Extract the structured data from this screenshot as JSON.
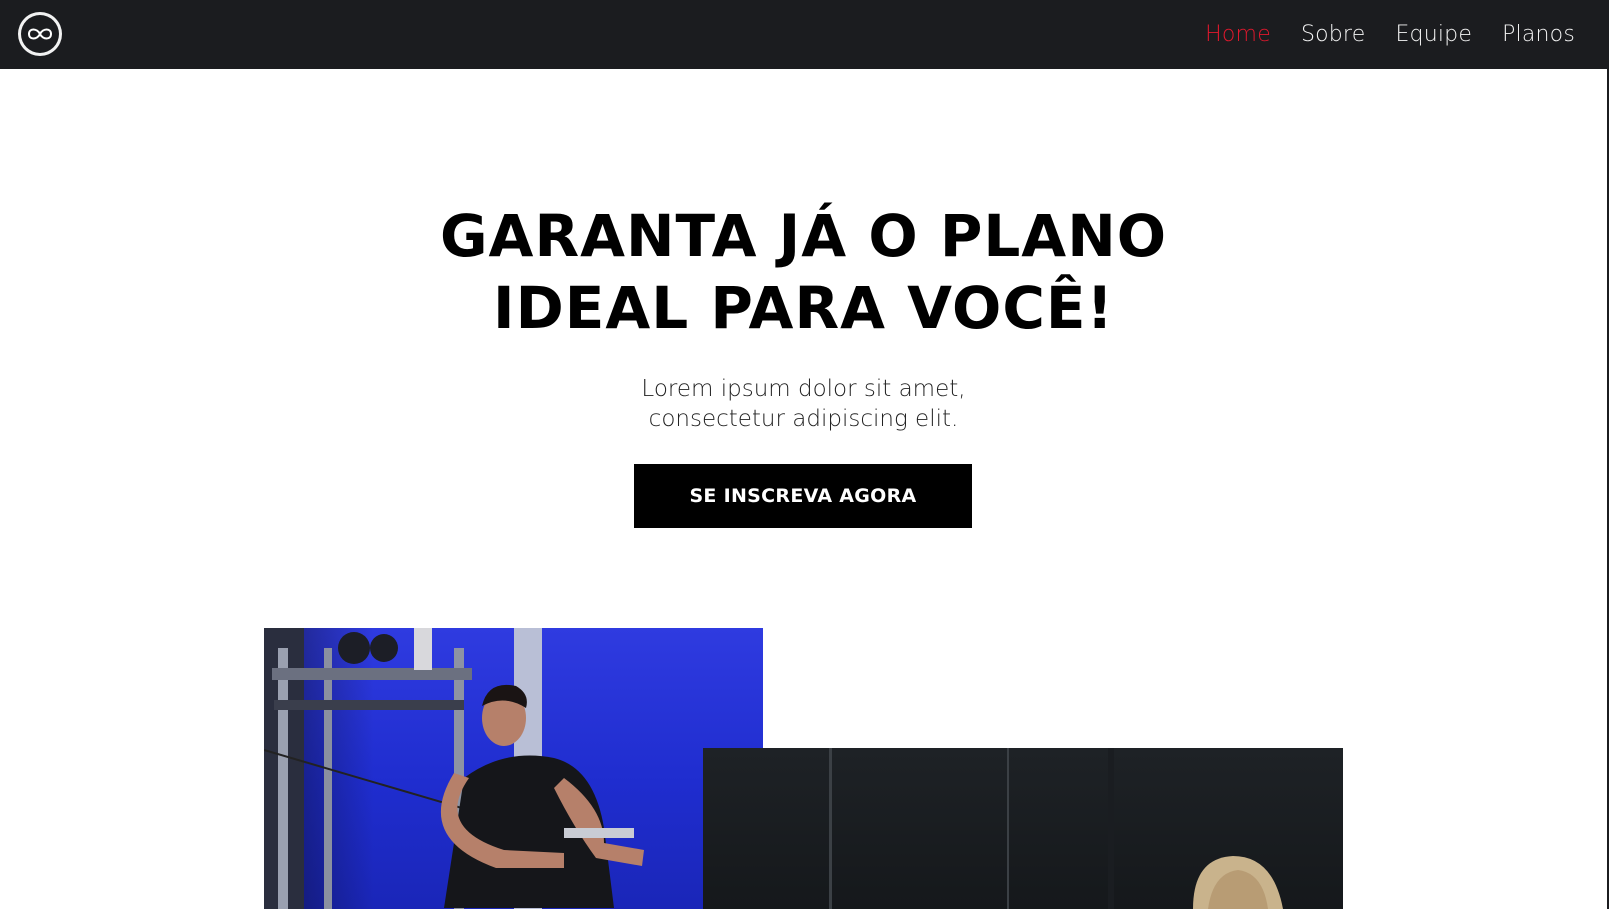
{
  "nav": {
    "logo_alt": "logo",
    "items": [
      {
        "label": "Home",
        "active": true
      },
      {
        "label": "Sobre",
        "active": false
      },
      {
        "label": "Equipe",
        "active": false
      },
      {
        "label": "Planos",
        "active": false
      }
    ]
  },
  "hero": {
    "title_line1": "GARANTA JÁ O PLANO",
    "title_line2": "IDEAL PARA VOCÊ!",
    "subtitle_line1": "Lorem ipsum dolor sit amet,",
    "subtitle_line2": "consectetur adipiscing elit.",
    "cta_label": "SE INSCREVA AGORA"
  },
  "colors": {
    "header_bg": "#1b1c1f",
    "active_link": "#e0182d",
    "cta_bg": "#000000"
  },
  "images": [
    {
      "name": "man-cable-workout-photo",
      "icon": "photo"
    },
    {
      "name": "woman-dark-gym-photo",
      "icon": "photo"
    }
  ]
}
